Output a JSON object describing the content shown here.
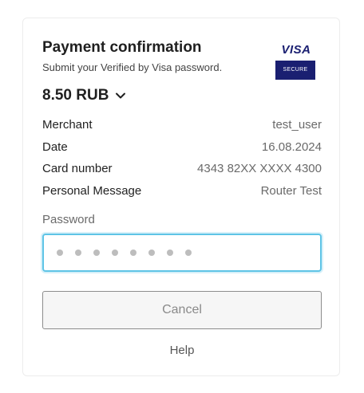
{
  "header": {
    "title": "Payment confirmation",
    "subtitle": "Submit your Verified by Visa password."
  },
  "logo": {
    "brand": "VISA",
    "badge": "SECURE",
    "color": "#1a1f71"
  },
  "amount": {
    "value": "8.50 RUB",
    "icon": "chevron-down-icon"
  },
  "details": [
    {
      "label": "Merchant",
      "value": "test_user"
    },
    {
      "label": "Date",
      "value": "16.08.2024"
    },
    {
      "label": "Card number",
      "value": "4343 82XX XXXX 4300"
    },
    {
      "label": "Personal Message",
      "value": "Router Test"
    }
  ],
  "password": {
    "label": "Password",
    "placeholder": "●●●●●●●●",
    "focus_color": "#5ec4e6"
  },
  "actions": {
    "cancel_label": "Cancel",
    "help_label": "Help"
  }
}
